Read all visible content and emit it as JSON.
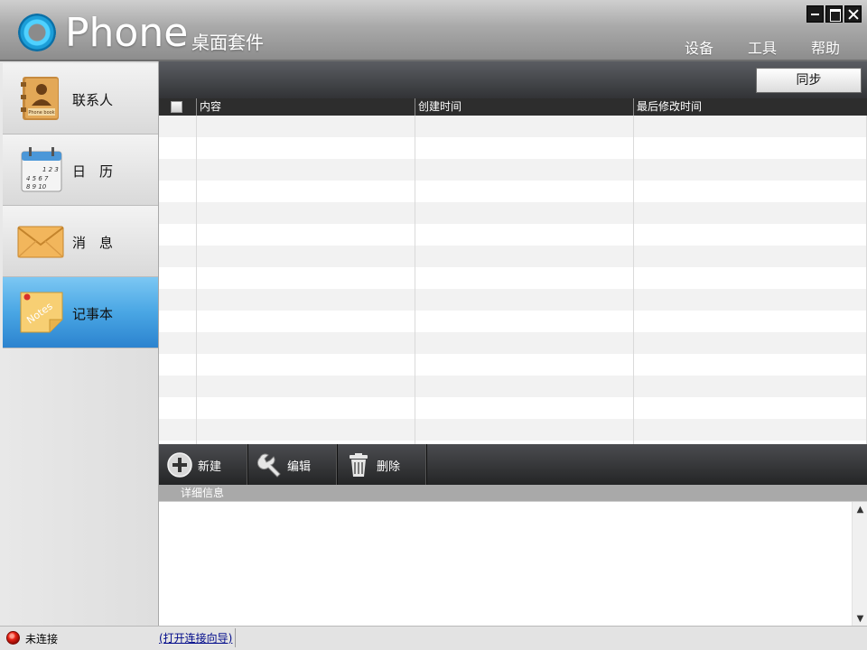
{
  "app": {
    "name": "Phone",
    "subtitle": "桌面套件"
  },
  "menu": [
    "设备",
    "工具",
    "帮助"
  ],
  "sidebar": {
    "items": [
      {
        "label": "联系人",
        "icon": "phone-book-icon",
        "active": false
      },
      {
        "label": "日　历",
        "icon": "calendar-icon",
        "active": false
      },
      {
        "label": "消　息",
        "icon": "envelope-icon",
        "active": false
      },
      {
        "label": "记事本",
        "icon": "notes-icon",
        "active": true
      }
    ]
  },
  "toolbar": {
    "sync_label": "同步"
  },
  "grid": {
    "columns": [
      "内容",
      "创建时间",
      "最后修改时间"
    ],
    "rows": []
  },
  "actions": [
    {
      "label": "新建",
      "icon": "plus-circle-icon"
    },
    {
      "label": "编辑",
      "icon": "wrench-icon"
    },
    {
      "label": "删除",
      "icon": "trash-can-icon"
    }
  ],
  "detail": {
    "header": "详细信息"
  },
  "status": {
    "connection": "未连接",
    "wizard_link": "(打开连接向导)"
  },
  "colors": {
    "active_nav": "#49a6e4",
    "header_dark": "#2d2d2d",
    "status_dot": "#e82216"
  }
}
